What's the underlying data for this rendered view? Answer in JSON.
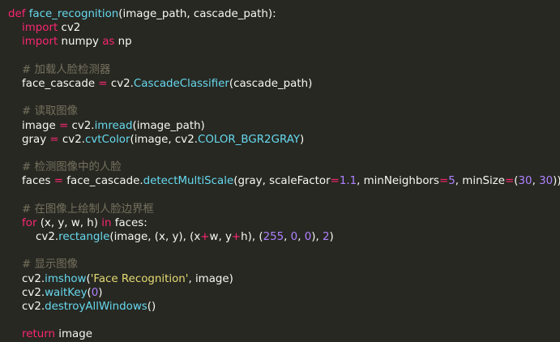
{
  "editor": {
    "theme_colors": {
      "background": "#272822",
      "text": "#f8f8f2",
      "keyword": "#f92672",
      "function": "#66d9ef",
      "comment": "#75715e",
      "number": "#ae81ff",
      "string": "#e6db74"
    },
    "lines": [
      [
        [
          "kw",
          "def "
        ],
        [
          "fn",
          "face_recognition"
        ],
        [
          "tx",
          "(image_path, cascade_path):"
        ]
      ],
      [
        [
          "tx",
          "    "
        ],
        [
          "kw",
          "import"
        ],
        [
          "tx",
          " cv2"
        ]
      ],
      [
        [
          "tx",
          "    "
        ],
        [
          "kw",
          "import"
        ],
        [
          "tx",
          " numpy "
        ],
        [
          "kw",
          "as"
        ],
        [
          "tx",
          " np"
        ]
      ],
      [],
      [
        [
          "tx",
          "    "
        ],
        [
          "cm",
          "# 加载人脸检测器"
        ]
      ],
      [
        [
          "tx",
          "    face_cascade "
        ],
        [
          "kw",
          "="
        ],
        [
          "tx",
          " cv2."
        ],
        [
          "fn",
          "CascadeClassifier"
        ],
        [
          "tx",
          "(cascade_path)"
        ]
      ],
      [],
      [
        [
          "tx",
          "    "
        ],
        [
          "cm",
          "# 读取图像"
        ]
      ],
      [
        [
          "tx",
          "    image "
        ],
        [
          "kw",
          "="
        ],
        [
          "tx",
          " cv2."
        ],
        [
          "fn",
          "imread"
        ],
        [
          "tx",
          "(image_path)"
        ]
      ],
      [
        [
          "tx",
          "    gray "
        ],
        [
          "kw",
          "="
        ],
        [
          "tx",
          " cv2."
        ],
        [
          "fn",
          "cvtColor"
        ],
        [
          "tx",
          "(image, cv2."
        ],
        [
          "fn",
          "COLOR_BGR2GRAY"
        ],
        [
          "tx",
          ")"
        ]
      ],
      [],
      [
        [
          "tx",
          "    "
        ],
        [
          "cm",
          "# 检测图像中的人脸"
        ]
      ],
      [
        [
          "tx",
          "    faces "
        ],
        [
          "kw",
          "="
        ],
        [
          "tx",
          " face_cascade."
        ],
        [
          "fn",
          "detectMultiScale"
        ],
        [
          "tx",
          "(gray, scaleFactor"
        ],
        [
          "kw",
          "="
        ],
        [
          "nm",
          "1.1"
        ],
        [
          "tx",
          ", minNeighbors"
        ],
        [
          "kw",
          "="
        ],
        [
          "nm",
          "5"
        ],
        [
          "tx",
          ", minSize"
        ],
        [
          "kw",
          "="
        ],
        [
          "tx",
          "("
        ],
        [
          "nm",
          "30"
        ],
        [
          "tx",
          ", "
        ],
        [
          "nm",
          "30"
        ],
        [
          "tx",
          "))"
        ]
      ],
      [],
      [
        [
          "tx",
          "    "
        ],
        [
          "cm",
          "# 在图像上绘制人脸边界框"
        ]
      ],
      [
        [
          "tx",
          "    "
        ],
        [
          "kw",
          "for"
        ],
        [
          "tx",
          " (x, y, w, h) "
        ],
        [
          "kw",
          "in"
        ],
        [
          "tx",
          " faces:"
        ]
      ],
      [
        [
          "tx",
          "        cv2."
        ],
        [
          "fn",
          "rectangle"
        ],
        [
          "tx",
          "(image, (x, y), (x"
        ],
        [
          "kw",
          "+"
        ],
        [
          "tx",
          "w, y"
        ],
        [
          "kw",
          "+"
        ],
        [
          "tx",
          "h), ("
        ],
        [
          "nm",
          "255"
        ],
        [
          "tx",
          ", "
        ],
        [
          "nm",
          "0"
        ],
        [
          "tx",
          ", "
        ],
        [
          "nm",
          "0"
        ],
        [
          "tx",
          "), "
        ],
        [
          "nm",
          "2"
        ],
        [
          "tx",
          ")"
        ]
      ],
      [],
      [
        [
          "tx",
          "    "
        ],
        [
          "cm",
          "# 显示图像"
        ]
      ],
      [
        [
          "tx",
          "    cv2."
        ],
        [
          "fn",
          "imshow"
        ],
        [
          "tx",
          "("
        ],
        [
          "st",
          "'Face Recognition'"
        ],
        [
          "tx",
          ", image)"
        ]
      ],
      [
        [
          "tx",
          "    cv2."
        ],
        [
          "fn",
          "waitKey"
        ],
        [
          "tx",
          "("
        ],
        [
          "nm",
          "0"
        ],
        [
          "tx",
          ")"
        ]
      ],
      [
        [
          "tx",
          "    cv2."
        ],
        [
          "fn",
          "destroyAllWindows"
        ],
        [
          "tx",
          "()"
        ]
      ],
      [],
      [
        [
          "tx",
          "    "
        ],
        [
          "kw",
          "return"
        ],
        [
          "tx",
          " image"
        ]
      ]
    ]
  }
}
